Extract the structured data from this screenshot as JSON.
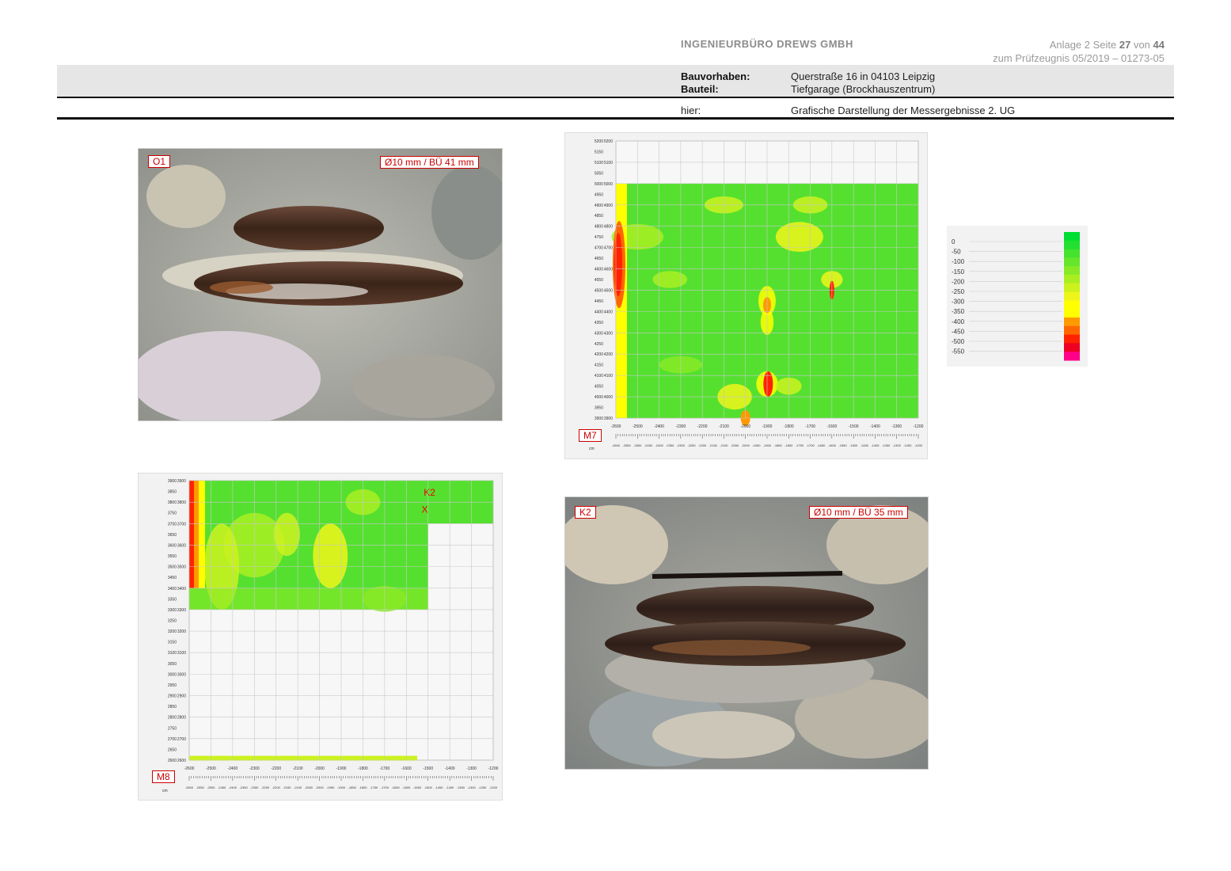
{
  "header": {
    "company": "INGENIEURBÜRO DREWS GMBH",
    "page_prefix": "Anlage 2 Seite ",
    "page_num": "27",
    "page_mid": " von ",
    "page_total": "44",
    "report_ref": "zum Prüfzeugnis 05/2019 – 01273-05",
    "bauvorhaben_label": "Bauvorhaben:",
    "bauvorhaben_value": "Querstraße 16 in 04103 Leipzig",
    "bauteil_label": "Bauteil:",
    "bauteil_value": "Tiefgarage (Brockhauszentrum)",
    "hier_label": "hier:",
    "hier_value": "Grafische Darstellung der Messergebnisse 2. UG"
  },
  "photos": [
    {
      "id": "O1",
      "label": "O1",
      "caption": "Ø10 mm / BÜ 41 mm"
    },
    {
      "id": "K2",
      "label": "K2",
      "caption": "Ø10 mm / BÜ 35 mm"
    }
  ],
  "colors": {
    "red_tag": "#cc0000",
    "green": "#22dd22",
    "yellow": "#ffff00",
    "orange": "#ff8800",
    "red": "#ff2200",
    "magenta": "#ff0088"
  },
  "chart_data": [
    {
      "type": "heatmap",
      "label": "M7",
      "x_range": [
        -2600,
        -1200
      ],
      "y_range": [
        3900,
        5200
      ],
      "x_ticks": [
        -2600,
        -2500,
        -2400,
        -2300,
        -2200,
        -2100,
        -2000,
        -1900,
        -1800,
        -1700,
        -1600,
        -1500,
        -1400,
        -1300,
        -1200
      ],
      "y_ticks": [
        3900,
        3950,
        4000,
        4050,
        4100,
        4150,
        4200,
        4250,
        4300,
        4350,
        4400,
        4450,
        4500,
        4550,
        4600,
        4650,
        4700,
        4750,
        4800,
        4850,
        4900,
        4950,
        5000,
        5050,
        5100,
        5150,
        5200
      ],
      "unit_label": "cm",
      "grid": true
    },
    {
      "type": "heatmap",
      "label": "M8",
      "x_range": [
        -2600,
        -1200
      ],
      "y_range": [
        2600,
        3900
      ],
      "x_ticks": [
        -2600,
        -2500,
        -2400,
        -2300,
        -2200,
        -2100,
        -2000,
        -1900,
        -1800,
        -1700,
        -1600,
        -1500,
        -1400,
        -1300,
        -1200
      ],
      "y_ticks": [
        2600,
        2650,
        2700,
        2750,
        2800,
        2850,
        2900,
        2950,
        3000,
        3050,
        3100,
        3150,
        3200,
        3250,
        3300,
        3350,
        3400,
        3450,
        3500,
        3550,
        3600,
        3650,
        3700,
        3750,
        3800,
        3850,
        3900
      ],
      "unit_label": "cm",
      "grid": true,
      "marker": {
        "label": "K2",
        "symbol": "X"
      }
    }
  ],
  "legend": {
    "values": [
      "0",
      "-50",
      "-100",
      "-150",
      "-200",
      "-250",
      "-300",
      "-350",
      "-400",
      "-450",
      "-500",
      "-550"
    ],
    "colors": [
      "#00dd33",
      "#22e030",
      "#44e32d",
      "#66e62a",
      "#88ea26",
      "#aaee22",
      "#ccf21e",
      "#eef51a",
      "#ffff00",
      "#ffff00",
      "#ff9900",
      "#ff6600",
      "#ff2200",
      "#ee0022",
      "#ff0088"
    ]
  }
}
